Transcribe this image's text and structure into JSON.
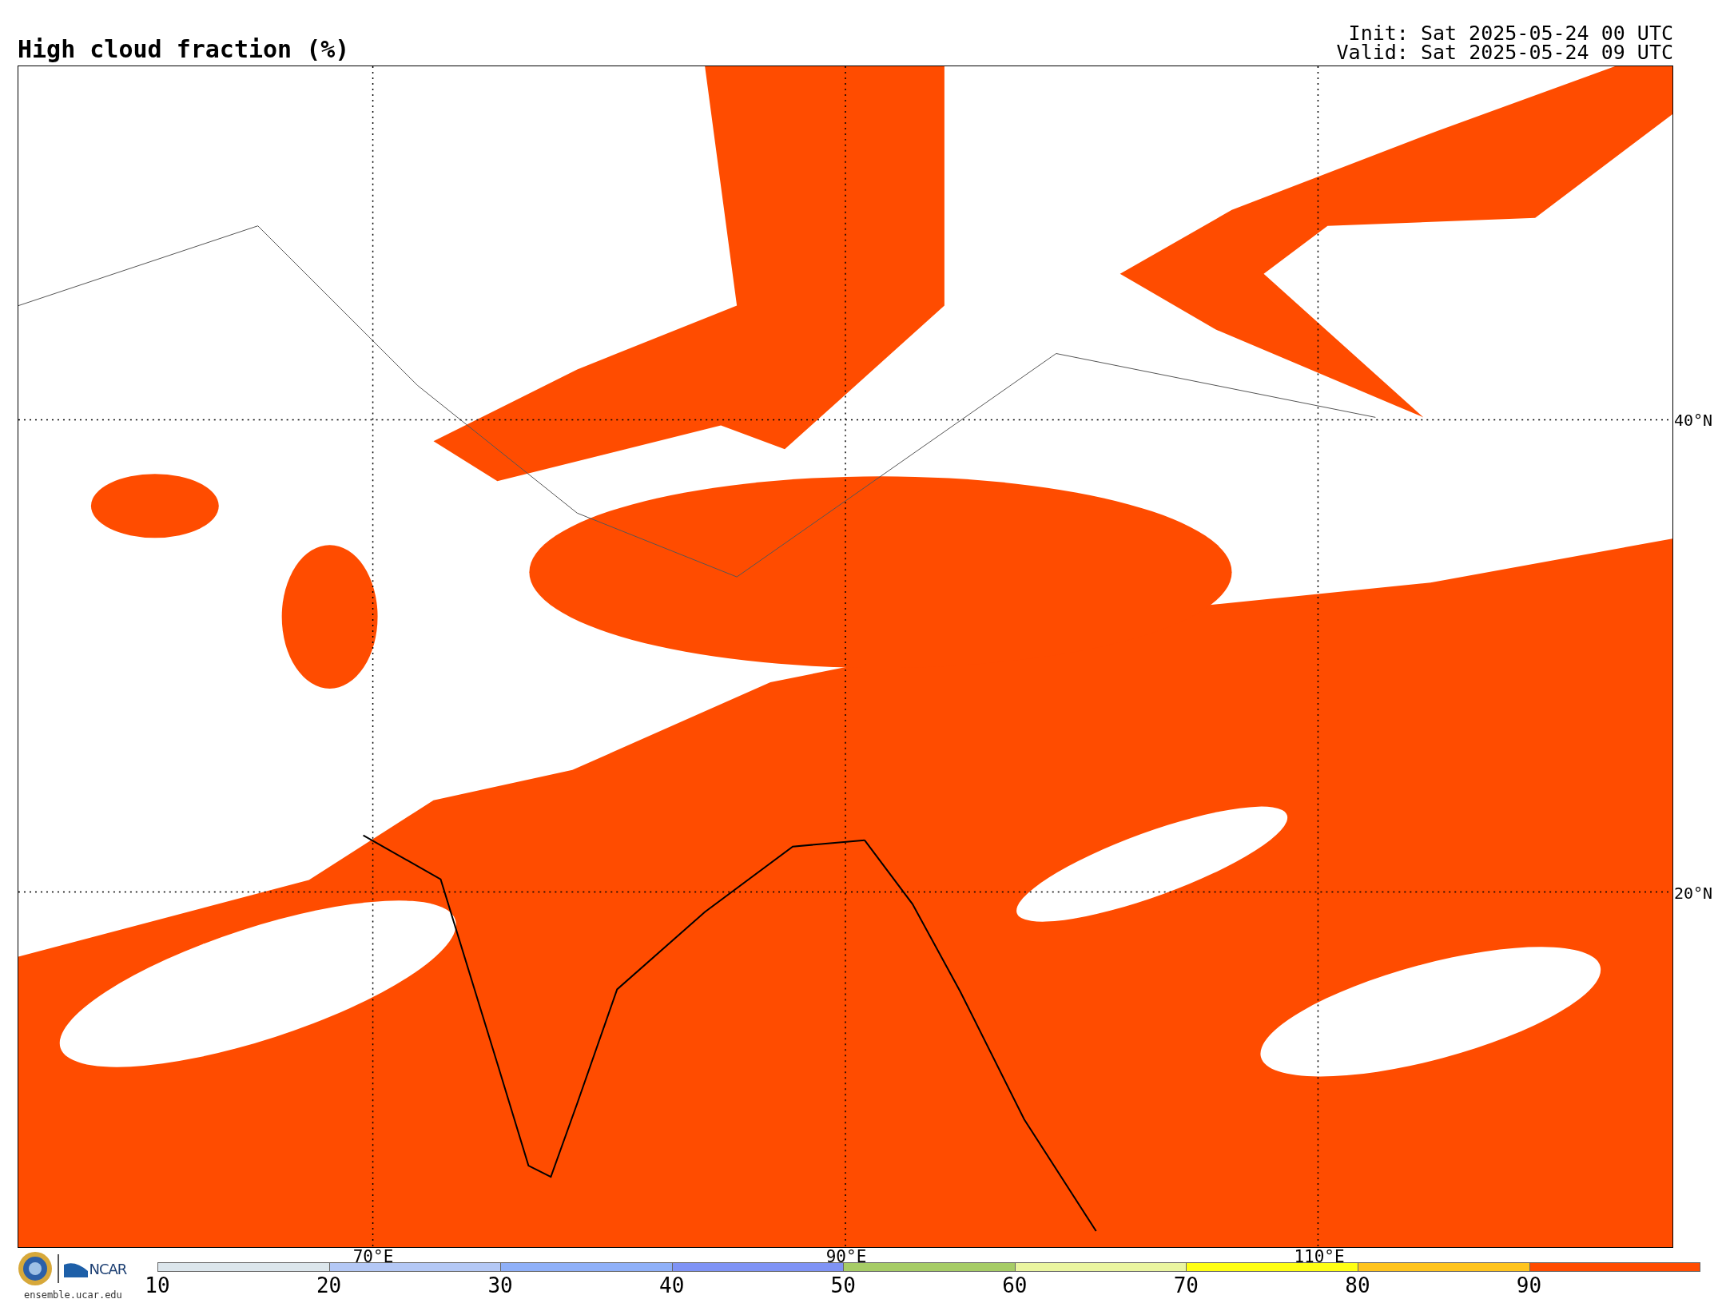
{
  "title": "High cloud fraction (%)",
  "run_info": {
    "init": "Init: Sat 2025-05-24 00 UTC",
    "valid": "Valid: Sat 2025-05-24 09 UTC"
  },
  "map": {
    "longitude_labels": [
      "70°E",
      "90°E",
      "110°E"
    ],
    "latitude_labels": [
      "40°N",
      "20°N"
    ]
  },
  "logo": {
    "wordmark": "NCAR",
    "url": "ensemble.ucar.edu"
  },
  "colorbar": [
    {
      "label": "10",
      "color": "#dce6ec"
    },
    {
      "label": "20",
      "color": "#b4c8f5"
    },
    {
      "label": "30",
      "color": "#8fb0f8"
    },
    {
      "label": "40",
      "color": "#7f93f5"
    },
    {
      "label": "50",
      "color": "#a6cc66"
    },
    {
      "label": "60",
      "color": "#eaf5a0"
    },
    {
      "label": "70",
      "color": "#ffff14"
    },
    {
      "label": "80",
      "color": "#ffc41e"
    },
    {
      "label": "90",
      "color": "#ff4c00"
    }
  ]
}
